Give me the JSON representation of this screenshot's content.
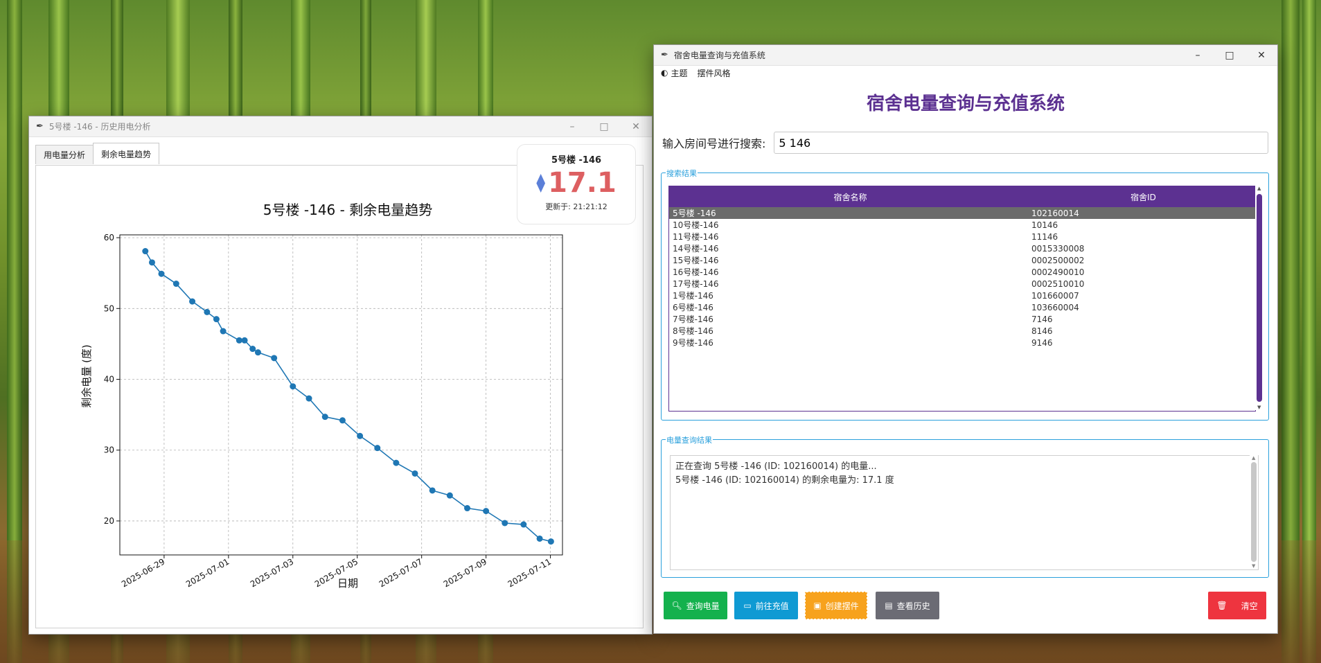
{
  "colors": {
    "accent_purple": "#5c3191",
    "value_red": "#dd5f61",
    "group_blue": "#2aa0dc",
    "btn_green": "#14b14d",
    "btn_blue": "#0f9ad3",
    "btn_orange": "#f7a21d",
    "btn_gray": "#6b6b74",
    "btn_red": "#ee343f"
  },
  "history_window": {
    "title": "5号楼 -146 - 历史用电分析",
    "tabs": [
      "用电量分析",
      "剩余电量趋势"
    ],
    "badge": {
      "room": "5号楼 -146",
      "value": "17.1",
      "updated": "更新于: 21:21:12",
      "icon": "diamond-icon"
    }
  },
  "chart_data": {
    "type": "line",
    "title": "5号楼 -146 - 剩余电量趋势",
    "xlabel": "日期",
    "ylabel": "剩余电量 (度)",
    "ylim": [
      15.2,
      60.4
    ],
    "yticks": [
      20,
      30,
      40,
      50,
      60
    ],
    "xticks": [
      "2025-06-29",
      "2025-07-01",
      "2025-07-03",
      "2025-07-05",
      "2025-07-07",
      "2025-07-09",
      "2025-07-11"
    ],
    "grid": true,
    "x": [
      "2025-06-28 10:00",
      "2025-06-28 15:00",
      "2025-06-28 22:00",
      "2025-06-29 09:00",
      "2025-06-29 21:00",
      "2025-06-30 08:00",
      "2025-06-30 15:00",
      "2025-06-30 20:00",
      "2025-07-01 08:00",
      "2025-07-01 12:00",
      "2025-07-01 18:00",
      "2025-07-01 22:00",
      "2025-07-02 10:00",
      "2025-07-03 00:00",
      "2025-07-03 12:00",
      "2025-07-04 00:00",
      "2025-07-04 13:00",
      "2025-07-05 02:00",
      "2025-07-05 15:00",
      "2025-07-06 05:00",
      "2025-07-06 19:00",
      "2025-07-07 08:00",
      "2025-07-07 21:00",
      "2025-07-08 10:00",
      "2025-07-09 00:00",
      "2025-07-09 14:00",
      "2025-07-10 04:00",
      "2025-07-10 16:00"
    ],
    "values": [
      58.1,
      56.5,
      54.9,
      53.5,
      51.0,
      49.5,
      48.5,
      46.8,
      45.5,
      45.5,
      44.3,
      43.8,
      43.0,
      39.0,
      37.3,
      34.7,
      34.2,
      32.0,
      30.3,
      28.2,
      26.7,
      24.3,
      23.6,
      21.8,
      21.4,
      19.7,
      19.5,
      17.5,
      17.1
    ],
    "line_color": "#1f77b4"
  },
  "main_window": {
    "title": "宿舍电量查询与充值系统",
    "menu": [
      {
        "icon": "palette-icon",
        "label": "主题"
      },
      {
        "label": "摆件风格"
      }
    ],
    "heading": "宿舍电量查询与充值系统",
    "search_label": "输入房间号进行搜索:",
    "search_value": "5 146",
    "results_label": "搜索结果",
    "table_headers": [
      "宿舍名称",
      "宿舍ID"
    ],
    "rows": [
      [
        "5号楼 -146",
        "102160014"
      ],
      [
        "10号楼-146",
        "10146"
      ],
      [
        "11号楼-146",
        "11146"
      ],
      [
        "14号楼-146",
        "0015330008"
      ],
      [
        "15号楼-146",
        "0002500002"
      ],
      [
        "16号楼-146",
        "0002490010"
      ],
      [
        "17号楼-146",
        "0002510010"
      ],
      [
        "1号楼-146",
        "101660007"
      ],
      [
        "6号楼-146",
        "103660004"
      ],
      [
        "7号楼-146",
        "7146"
      ],
      [
        "8号楼-146",
        "8146"
      ],
      [
        "9号楼-146",
        "9146"
      ]
    ],
    "result_label": "电量查询结果",
    "log_lines": [
      "正在查询 5号楼 -146 (ID: 102160014) 的电量...",
      "5号楼 -146 (ID: 102160014) 的剩余电量为: 17.1 度"
    ],
    "buttons": [
      {
        "label": "查询电量",
        "icon": "search-icon"
      },
      {
        "label": "前往充值",
        "icon": "card-icon"
      },
      {
        "label": "创建摆件",
        "icon": "widget-icon"
      },
      {
        "label": "查看历史",
        "icon": "chart-icon"
      },
      {
        "label": "清空",
        "icon": "trash-icon"
      }
    ]
  }
}
